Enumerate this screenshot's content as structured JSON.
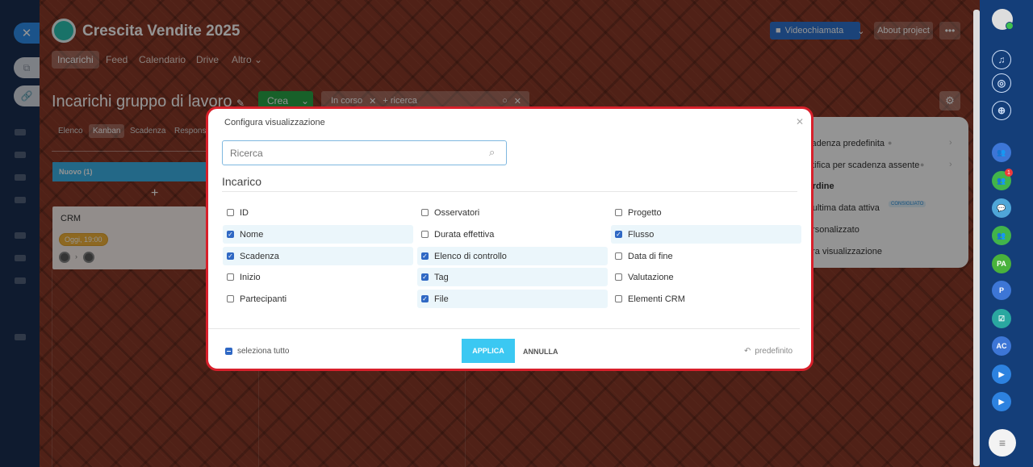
{
  "project": {
    "title": "Crescita Vendite 2025",
    "tabs": [
      "Incarichi",
      "Feed",
      "Calendario",
      "Drive",
      "Altro"
    ],
    "video_label": "Videochiamata",
    "about_label": "About project",
    "more_label": "•••"
  },
  "main": {
    "heading": "Incarichi gruppo di lavoro",
    "create_label": "Crea",
    "filter_tag": "In corso",
    "filter_placeholder": "+ ricerca",
    "view_tabs": [
      "Elenco",
      "Kanban",
      "Scadenza",
      "Respons"
    ],
    "column_title": "Nuovo (1)",
    "card": {
      "title": "CRM",
      "deadline": "Oggi, 19:00"
    }
  },
  "settings_popup": {
    "items": [
      "cadenza predefinita",
      "otifica per scadenza assente",
      "ordine",
      "r ultima data attiva",
      "ersonalizzato",
      "ura visualizzazione"
    ],
    "badge": "CONSIGLIATO"
  },
  "modal": {
    "title": "Configura visualizzazione",
    "search_placeholder": "Ricerca",
    "section": "Incarico",
    "options": [
      {
        "label": "ID",
        "checked": false
      },
      {
        "label": "Osservatori",
        "checked": false
      },
      {
        "label": "Progetto",
        "checked": false
      },
      {
        "label": "Nome",
        "checked": true
      },
      {
        "label": "Durata effettiva",
        "checked": false
      },
      {
        "label": "Flusso",
        "checked": true
      },
      {
        "label": "Scadenza",
        "checked": true
      },
      {
        "label": "Elenco di controllo",
        "checked": true
      },
      {
        "label": "Data di fine",
        "checked": false
      },
      {
        "label": "Inizio",
        "checked": false
      },
      {
        "label": "Tag",
        "checked": true
      },
      {
        "label": "Valutazione",
        "checked": false
      },
      {
        "label": "Partecipanti",
        "checked": false
      },
      {
        "label": "File",
        "checked": true
      },
      {
        "label": "Elementi CRM",
        "checked": false
      }
    ],
    "select_all": "seleziona tutto",
    "apply": "APPLICA",
    "cancel": "ANNULLA",
    "reset": "predefinito"
  },
  "rightbar": {
    "badge_count": "1",
    "avatars": [
      "PA",
      "P",
      "AC"
    ]
  },
  "colors": {
    "accent": "#3bc8f2",
    "checkbox": "#2f68c4",
    "highlight_border": "#d8202b",
    "create_green": "#2aa548"
  }
}
